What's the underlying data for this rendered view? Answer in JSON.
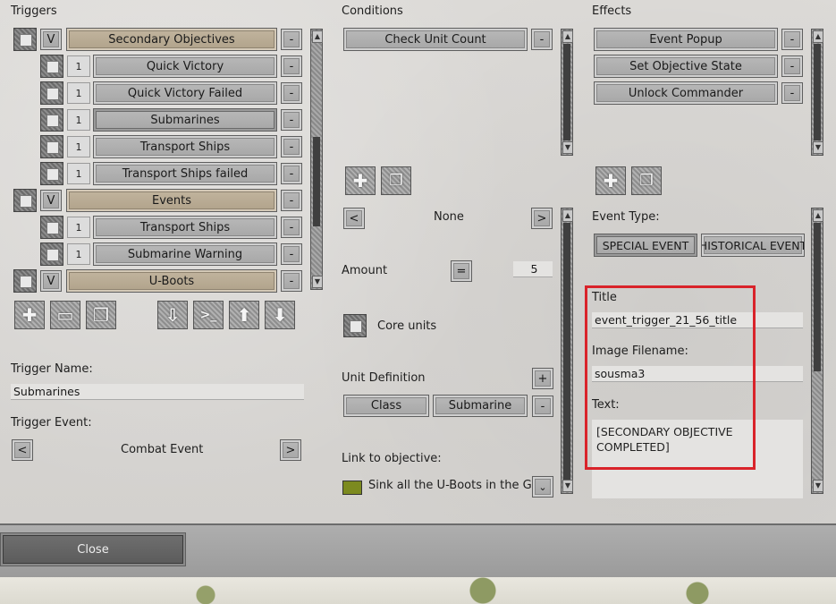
{
  "headers": {
    "triggers": "Triggers",
    "conditions": "Conditions",
    "effects": "Effects"
  },
  "triggers": [
    {
      "kind": "group",
      "badge": "V",
      "label": "Secondary Objectives"
    },
    {
      "kind": "item",
      "badge": "1",
      "label": "Quick Victory"
    },
    {
      "kind": "item",
      "badge": "1",
      "label": "Quick Victory Failed"
    },
    {
      "kind": "item",
      "badge": "1",
      "label": "Submarines",
      "selected": true
    },
    {
      "kind": "item",
      "badge": "1",
      "label": "Transport Ships"
    },
    {
      "kind": "item",
      "badge": "1",
      "label": "Transport Ships failed"
    },
    {
      "kind": "group",
      "badge": "V",
      "label": "Events"
    },
    {
      "kind": "item",
      "badge": "1",
      "label": "Transport Ships"
    },
    {
      "kind": "item",
      "badge": "1",
      "label": "Submarine Warning"
    },
    {
      "kind": "group",
      "badge": "V",
      "label": "U-Boots"
    }
  ],
  "remove_label": "-",
  "trigger_tools": [
    "add-icon",
    "folder-icon",
    "copy-icon",
    "import-icon",
    "console-icon",
    "arrow-up-icon",
    "arrow-down-icon"
  ],
  "trigger_tool_glyphs": [
    "✚",
    "▭",
    "❐",
    "⇩",
    ">_",
    "⬆",
    "⬇"
  ],
  "trigger_name": {
    "label": "Trigger Name:",
    "value": "Submarines"
  },
  "trigger_event": {
    "label": "Trigger Event:",
    "value": "Combat Event",
    "prev": "<",
    "next": ">"
  },
  "conditions": {
    "items": [
      "Check Unit Count"
    ],
    "tool_glyphs": [
      "✚",
      "❐"
    ],
    "selector": {
      "prev": "<",
      "value": "None",
      "next": ">"
    },
    "amount": {
      "label": "Amount",
      "op": "=",
      "value": "5"
    },
    "core_units": "Core units",
    "unit_definition": {
      "label": "Unit Definition",
      "add": "+",
      "cells": [
        "Class",
        "Submarine"
      ]
    },
    "link": {
      "label": "Link to objective:",
      "value": "Sink all the U-Boots in the Golf",
      "swatch": "#7c8a1f"
    }
  },
  "effects": {
    "items": [
      "Event Popup",
      "Set Objective State",
      "Unlock Commander"
    ],
    "tool_glyphs": [
      "✚",
      "❐"
    ],
    "event_type": {
      "label": "Event Type:",
      "options": [
        "SPECIAL EVENT",
        "HISTORICAL EVENT"
      ],
      "selected": "SPECIAL EVENT"
    },
    "title": {
      "label": "Title",
      "value": "event_trigger_21_56_title"
    },
    "image": {
      "label": "Image Filename:",
      "value": "sousma3"
    },
    "text": {
      "label": "Text:",
      "line1": "[SECONDARY OBJECTIVE",
      "line2": "COMPLETED]"
    }
  },
  "close_label": "Close",
  "highlight_color": "#d9232a"
}
